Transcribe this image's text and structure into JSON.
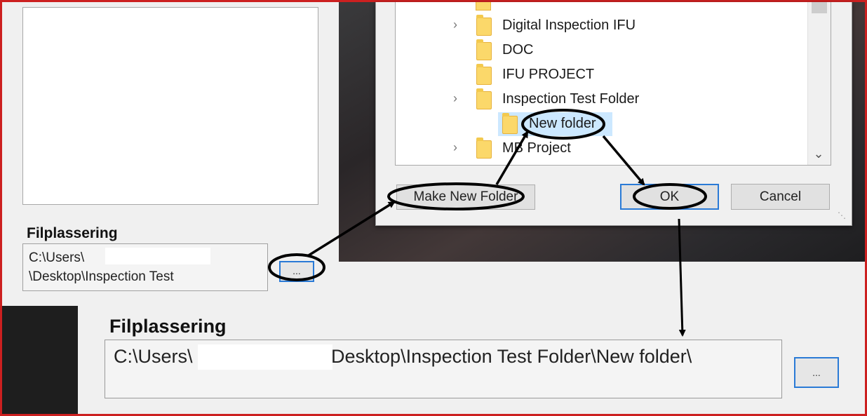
{
  "top_panel": {
    "location_label": "Filplassering",
    "path_line1": "C:\\Users\\",
    "path_line2": "\\Desktop\\Inspection Test",
    "browse_label": "..."
  },
  "dialog": {
    "tree_items": [
      {
        "label": "Digital Inspection IFU",
        "expandable": true
      },
      {
        "label": "DOC",
        "expandable": false
      },
      {
        "label": "IFU PROJECT",
        "expandable": false
      },
      {
        "label": "Inspection Test Folder",
        "expandable": true
      },
      {
        "label": "New folder",
        "expandable": false,
        "selected": true
      },
      {
        "label": "MB Project",
        "expandable": true
      }
    ],
    "make_new_folder_label": "Make New Folder",
    "ok_label": "OK",
    "cancel_label": "Cancel"
  },
  "bottom_panel": {
    "location_label": "Filplassering",
    "path_prefix": "C:\\Users\\",
    "path_suffix": "\\Desktop\\Inspection Test Folder\\New folder\\",
    "browse_label": "..."
  },
  "colors": {
    "frame_border": "#cc2020",
    "folder": "#fbd86a",
    "selection": "#cce8ff",
    "focus_border": "#2a7ad6"
  }
}
